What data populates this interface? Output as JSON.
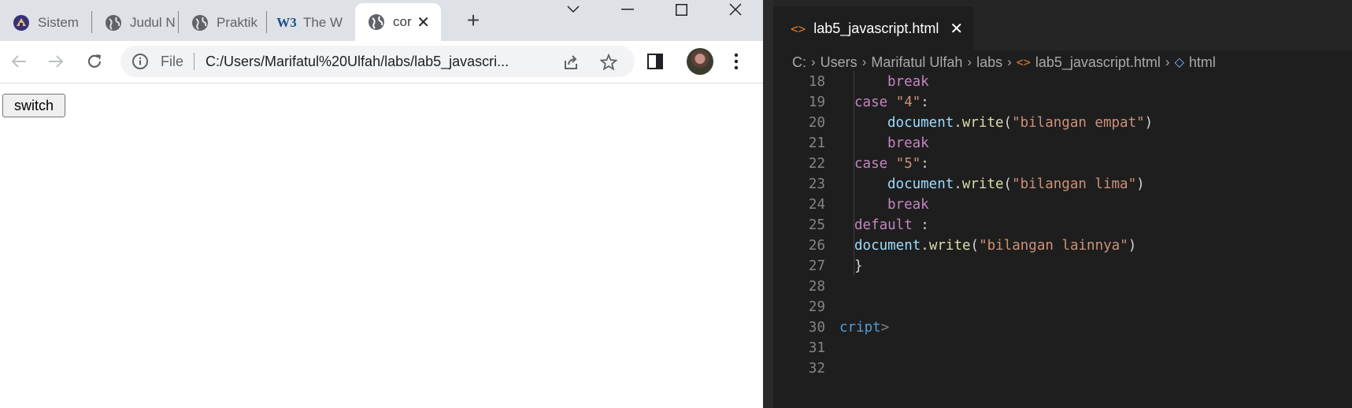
{
  "browser": {
    "tabs": [
      {
        "label": "Sistem",
        "icon": "university-logo-icon"
      },
      {
        "label": "Judul N",
        "icon": "globe-icon"
      },
      {
        "label": "Praktik",
        "icon": "globe-icon"
      },
      {
        "label": "The W",
        "icon": "w3schools-icon"
      },
      {
        "label": "cor",
        "icon": "globe-icon",
        "active": true
      }
    ],
    "new_tab_label": "+",
    "omnibox": {
      "scheme_label": "File",
      "url": "C:/Users/Marifatul%20Ulfah/labs/lab5_javascri..."
    },
    "page": {
      "button_label": "switch"
    }
  },
  "editor": {
    "tab": {
      "icon_glyph": "<>",
      "label": "lab5_javascript.html",
      "close": "✕"
    },
    "breadcrumb": [
      "C:",
      "Users",
      "Marifatul Ulfah",
      "labs",
      "lab5_javascript.html",
      "html"
    ],
    "lines": [
      {
        "n": "18",
        "indent": 2,
        "tokens": [
          {
            "t": "break",
            "c": "kw"
          }
        ]
      },
      {
        "n": "19",
        "indent": 1,
        "tokens": [
          {
            "t": "case ",
            "c": "kw"
          },
          {
            "t": "\"4\"",
            "c": "str"
          },
          {
            "t": ":",
            "c": "pn"
          }
        ]
      },
      {
        "n": "20",
        "indent": 2,
        "tokens": [
          {
            "t": "document",
            "c": "obj"
          },
          {
            "t": ".",
            "c": "pn"
          },
          {
            "t": "write",
            "c": "fn"
          },
          {
            "t": "(",
            "c": "pn"
          },
          {
            "t": "\"bilangan empat\"",
            "c": "str"
          },
          {
            "t": ")",
            "c": "pn"
          }
        ]
      },
      {
        "n": "21",
        "indent": 2,
        "tokens": [
          {
            "t": "break",
            "c": "kw"
          }
        ]
      },
      {
        "n": "22",
        "indent": 1,
        "tokens": [
          {
            "t": "case ",
            "c": "kw"
          },
          {
            "t": "\"5\"",
            "c": "str"
          },
          {
            "t": ":",
            "c": "pn"
          }
        ]
      },
      {
        "n": "23",
        "indent": 2,
        "tokens": [
          {
            "t": "document",
            "c": "obj"
          },
          {
            "t": ".",
            "c": "pn"
          },
          {
            "t": "write",
            "c": "fn"
          },
          {
            "t": "(",
            "c": "pn"
          },
          {
            "t": "\"bilangan lima\"",
            "c": "str"
          },
          {
            "t": ")",
            "c": "pn"
          }
        ]
      },
      {
        "n": "24",
        "indent": 2,
        "tokens": [
          {
            "t": "break",
            "c": "kw"
          }
        ]
      },
      {
        "n": "25",
        "indent": 1,
        "tokens": [
          {
            "t": "default",
            "c": "kw"
          },
          {
            "t": " :",
            "c": "pn"
          }
        ]
      },
      {
        "n": "26",
        "indent": 1,
        "tokens": [
          {
            "t": "document",
            "c": "obj"
          },
          {
            "t": ".",
            "c": "pn"
          },
          {
            "t": "write",
            "c": "fn"
          },
          {
            "t": "(",
            "c": "pn"
          },
          {
            "t": "\"bilangan lainnya\"",
            "c": "str"
          },
          {
            "t": ")",
            "c": "pn"
          }
        ]
      },
      {
        "n": "27",
        "indent": 1,
        "tokens": [
          {
            "t": "}",
            "c": "pn"
          }
        ]
      },
      {
        "n": "28",
        "indent": 0,
        "tokens": []
      },
      {
        "n": "29",
        "indent": 0,
        "tokens": []
      },
      {
        "n": "30",
        "indent": 0,
        "tokens": [
          {
            "t": "cript",
            "c": "tag"
          },
          {
            "t": ">",
            "c": "tagend"
          }
        ]
      },
      {
        "n": "31",
        "indent": 0,
        "tokens": []
      },
      {
        "n": "32",
        "indent": 0,
        "tokens": []
      }
    ]
  },
  "colors": {
    "chrome_tabstrip": "#dee1e6",
    "vscode_bg": "#1e1e1e",
    "keyword": "#c586c0",
    "string": "#ce9178",
    "variable": "#9cdcfe",
    "function": "#dcdcaa",
    "tag": "#569cd6"
  }
}
